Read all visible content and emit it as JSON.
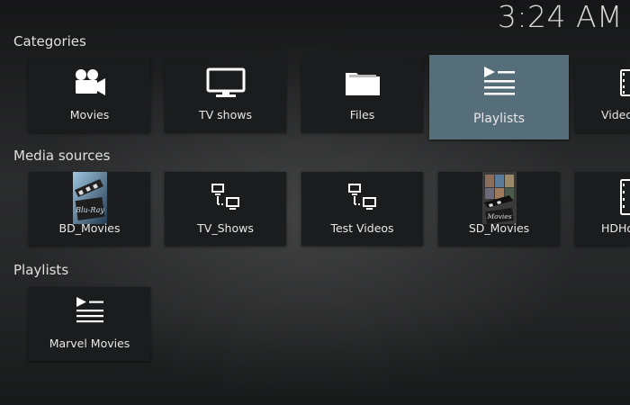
{
  "clock": "3:24 AM",
  "sections": {
    "categories": {
      "title": "Categories",
      "items": [
        {
          "label": "Movies",
          "icon": "movie-camera-icon"
        },
        {
          "label": "TV shows",
          "icon": "tv-icon"
        },
        {
          "label": "Files",
          "icon": "folder-icon"
        },
        {
          "label": "Playlists",
          "icon": "playlist-icon"
        },
        {
          "label": "Video",
          "icon": "film-strip-icon"
        }
      ]
    },
    "media_sources": {
      "title": "Media sources",
      "items": [
        {
          "label": "BD_Movies",
          "icon": "bluray-thumbnail"
        },
        {
          "label": "TV_Shows",
          "icon": "network-icon"
        },
        {
          "label": "Test Videos",
          "icon": "network-icon"
        },
        {
          "label": "SD_Movies",
          "icon": "movies-thumbnail"
        },
        {
          "label": "HDHo",
          "icon": "film-strip-icon"
        }
      ]
    },
    "playlists": {
      "title": "Playlists",
      "items": [
        {
          "label": "Marvel Movies",
          "icon": "playlist-icon"
        }
      ]
    }
  },
  "focused_item": "Playlists",
  "colors": {
    "focus": "#566d7a",
    "tile": "#1b1c1d",
    "text": "#e8e8e8"
  }
}
